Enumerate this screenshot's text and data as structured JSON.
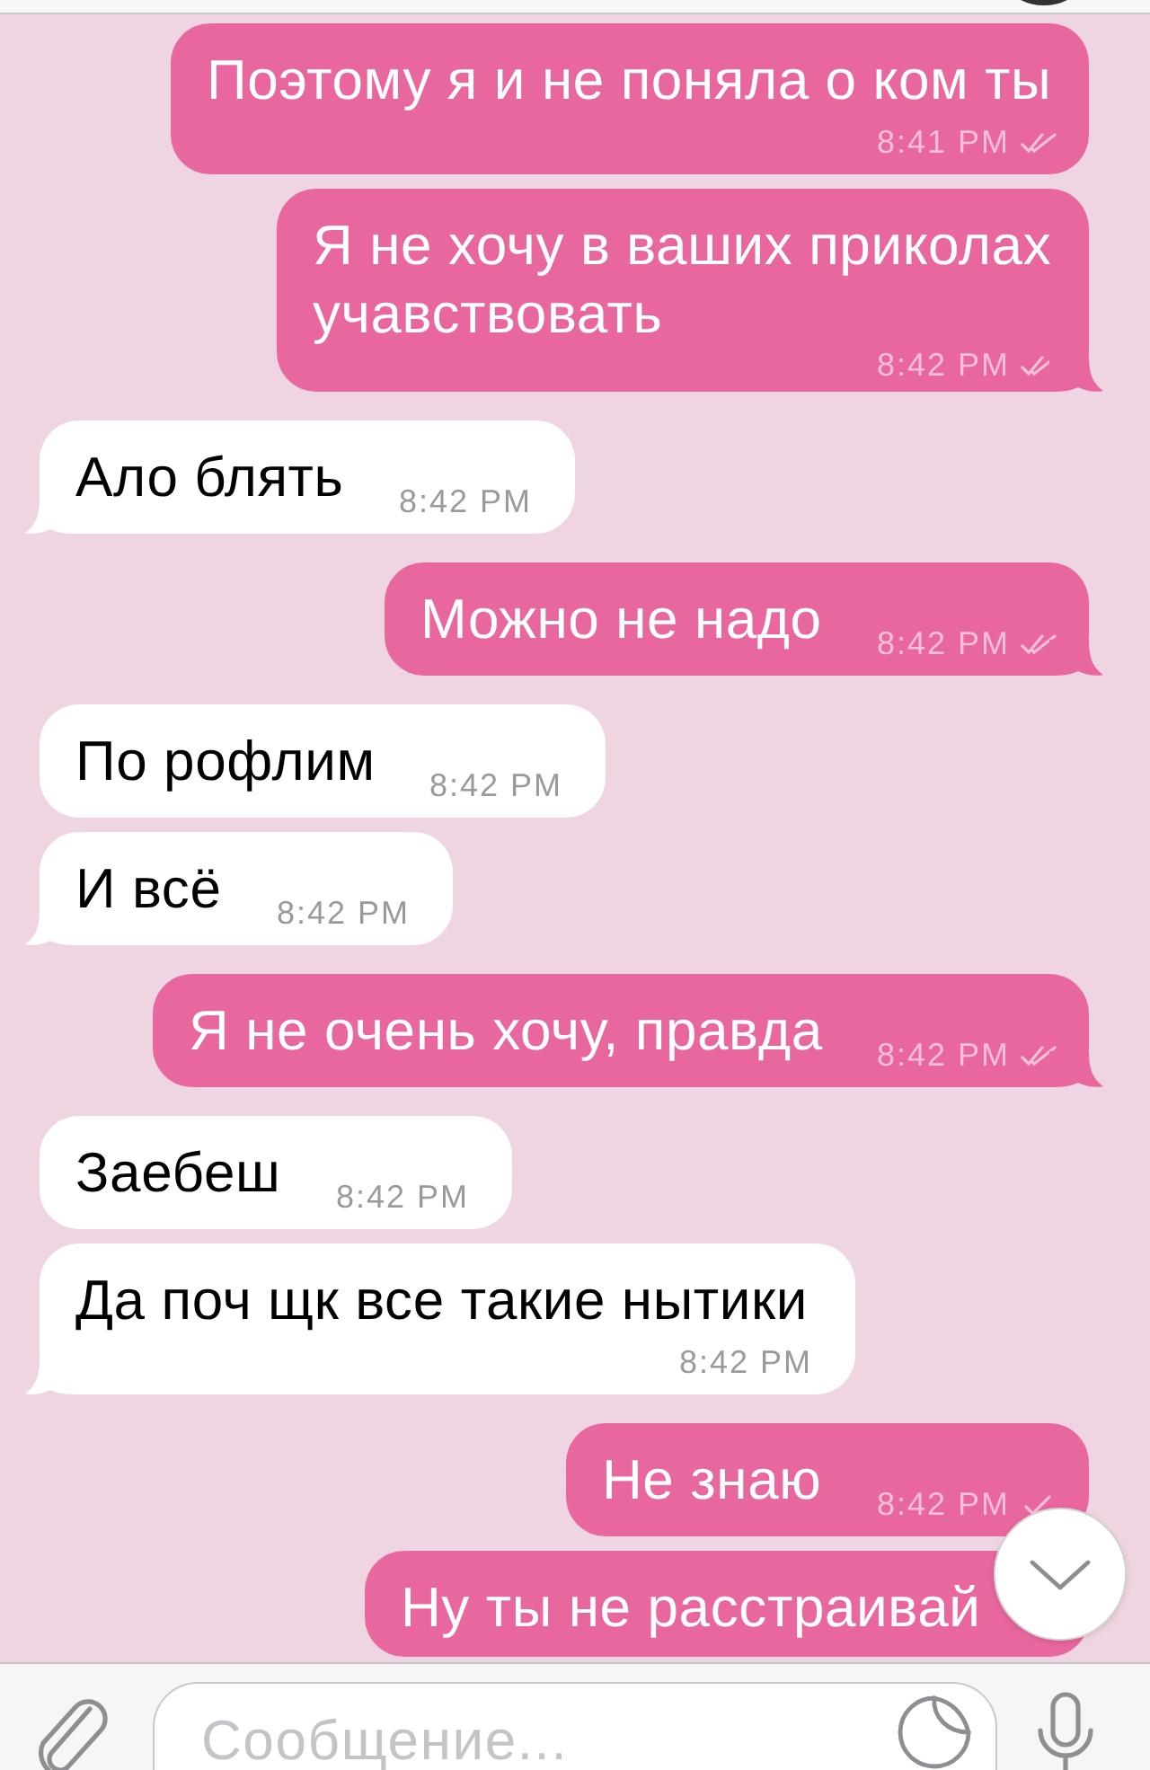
{
  "messages": [
    {
      "kind": "outgoing",
      "text": "Поэтому я и не поняла о ком ты",
      "time": "8:41 PM",
      "read": true,
      "tail": false
    },
    {
      "kind": "outgoing",
      "text": "Я не хочу в ваших приколах учавствовать",
      "time": "8:42 PM",
      "read": true,
      "tail": true
    },
    {
      "kind": "incoming",
      "text": "Ало блять",
      "time": "8:42 PM",
      "tail": true
    },
    {
      "kind": "outgoing",
      "text": "Можно не надо",
      "time": "8:42 PM",
      "read": true,
      "tail": true
    },
    {
      "kind": "incoming",
      "text": "По рофлим",
      "time": "8:42 PM",
      "tail": false
    },
    {
      "kind": "incoming",
      "text": "И всё",
      "time": "8:42 PM",
      "tail": true
    },
    {
      "kind": "outgoing",
      "text": "Я не очень хочу, правда",
      "time": "8:42 PM",
      "read": true,
      "tail": true
    },
    {
      "kind": "incoming",
      "text": "Заебеш",
      "time": "8:42 PM",
      "tail": false
    },
    {
      "kind": "incoming",
      "text": "Да поч щк все такие нытики",
      "time": "8:42 PM",
      "tail": true
    },
    {
      "kind": "outgoing",
      "text": "Не знаю",
      "time": "8:42 PM",
      "read": false,
      "tail": false
    },
    {
      "kind": "outgoing",
      "text": "Ну ты не расстраивай",
      "tail": false
    }
  ],
  "composer": {
    "placeholder": "Сообщение..."
  }
}
